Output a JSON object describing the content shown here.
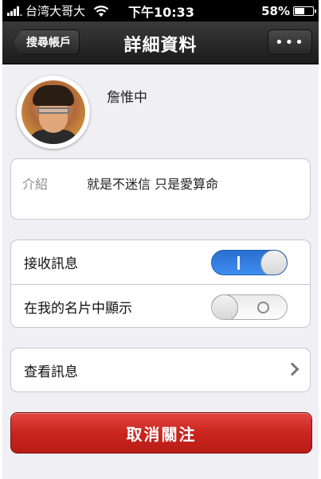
{
  "status_bar": {
    "carrier": "台湾大哥大",
    "time": "下午10:33",
    "battery": "58%",
    "battery_level": 0.58
  },
  "nav": {
    "back_label": "搜尋帳戶",
    "title": "詳細資料",
    "more_label": "•••"
  },
  "profile": {
    "name": "詹惟中"
  },
  "intro": {
    "label": "介紹",
    "text": "就是不迷信 只是愛算命"
  },
  "settings": [
    {
      "label": "接收訊息",
      "enabled": true
    },
    {
      "label": "在我的名片中顯示",
      "enabled": false
    }
  ],
  "view_messages": {
    "label": "查看訊息"
  },
  "unfollow_button": {
    "label": "取消關注",
    "color": "#c9261f"
  }
}
